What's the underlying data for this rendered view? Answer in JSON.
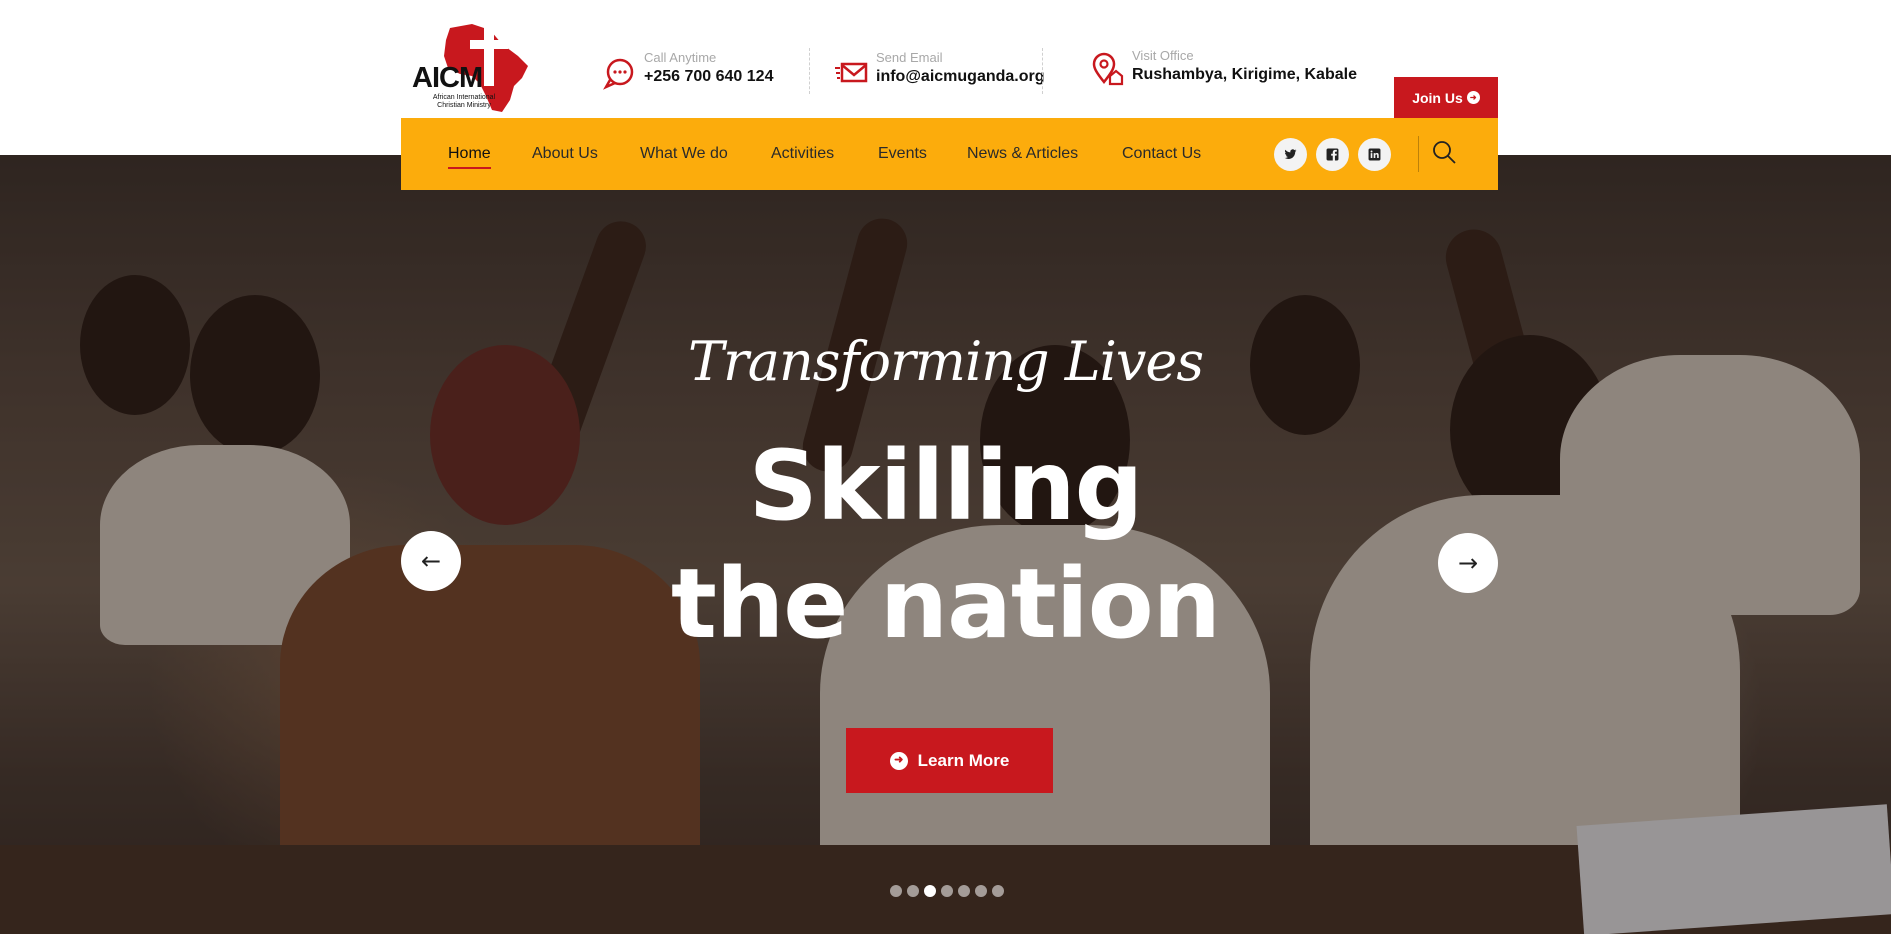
{
  "brand": {
    "logo_text": "AICM",
    "logo_subtitle": "African International Christian Ministry",
    "accent_red": "#c8181e",
    "nav_yellow": "#fcac0c"
  },
  "contacts": [
    {
      "label": "Call Anytime",
      "value": "+256 700 640 124",
      "icon": "chat-phone-icon"
    },
    {
      "label": "Send Email",
      "value": "info@aicmuganda.org",
      "icon": "mail-icon"
    },
    {
      "label": "Visit Office",
      "value": "Rushambya, Kirigime, Kabale",
      "icon": "location-pin-icon"
    }
  ],
  "join_button": {
    "label": "Join Us",
    "icon": "arrow-circle-right-icon"
  },
  "nav": {
    "items": [
      {
        "label": "Home"
      },
      {
        "label": "About Us"
      },
      {
        "label": "What We do"
      },
      {
        "label": "Activities"
      },
      {
        "label": "Events"
      },
      {
        "label": "News & Articles"
      },
      {
        "label": "Contact Us"
      }
    ],
    "active": "Home",
    "social": [
      "twitter-icon",
      "facebook-icon",
      "linkedin-icon"
    ],
    "search_icon": "search-icon"
  },
  "hero": {
    "script_title": "Transforming Lives",
    "title_line1": "Skilling",
    "title_line2": "the nation",
    "cta_label": "Learn More",
    "prev_icon": "arrow-left-icon",
    "next_icon": "arrow-right-icon",
    "slide_count": 7,
    "active_slide": 3
  }
}
